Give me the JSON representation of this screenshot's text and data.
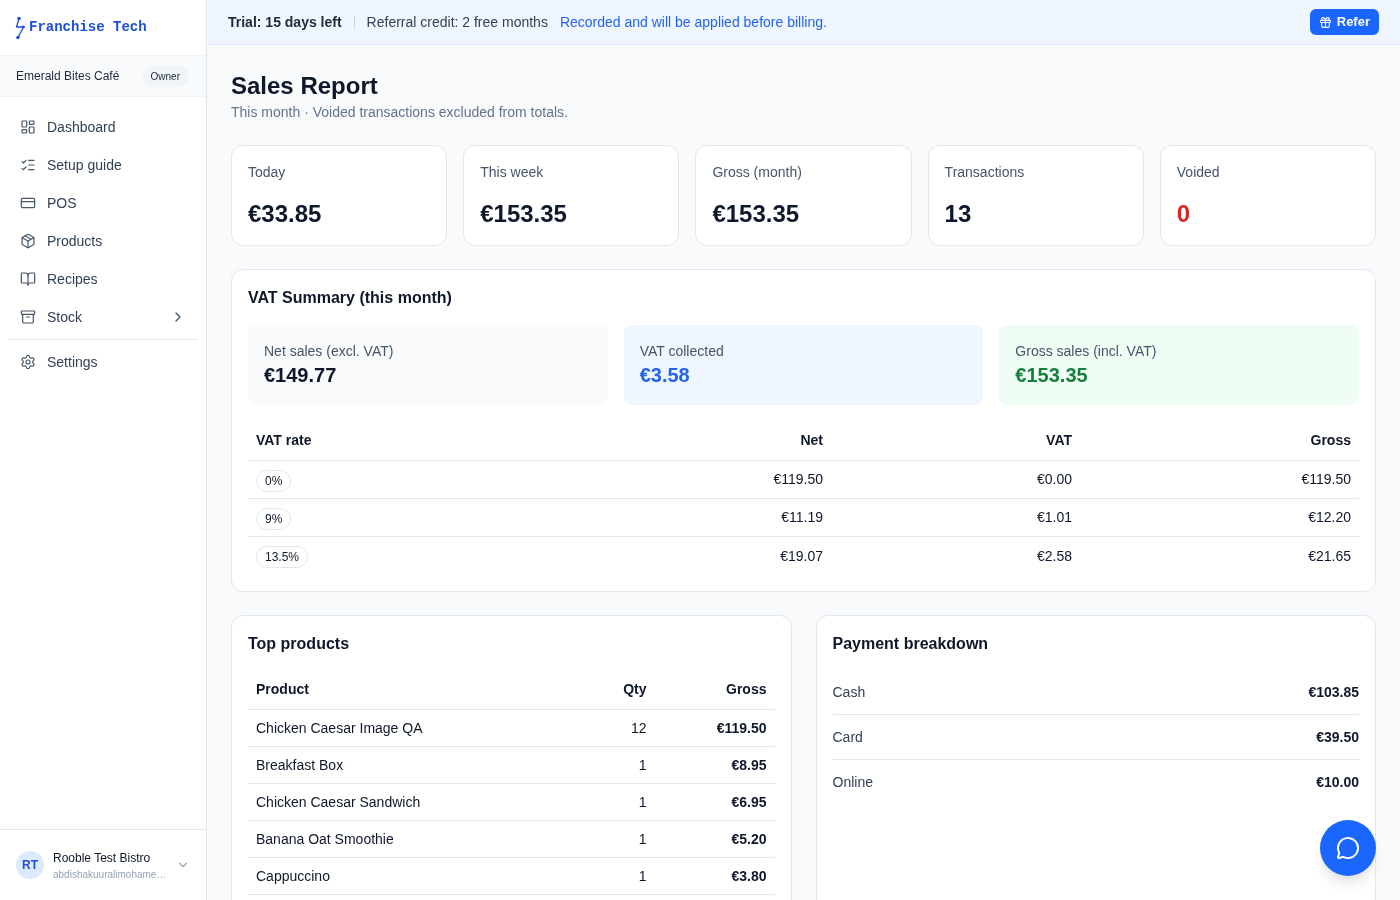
{
  "sidebar": {
    "brand": "Franchise Tech",
    "store": {
      "name": "Emerald Bites Café",
      "role": "Owner"
    },
    "nav": [
      {
        "label": "Dashboard",
        "kind": "link"
      },
      {
        "label": "Setup guide",
        "kind": "link"
      },
      {
        "label": "POS",
        "kind": "link"
      },
      {
        "label": "Products",
        "kind": "link"
      },
      {
        "label": "Recipes",
        "kind": "link"
      },
      {
        "label": "Stock",
        "kind": "group",
        "expanded": false
      }
    ],
    "secondary_nav": [
      {
        "label": "Settings",
        "kind": "link"
      }
    ],
    "user": {
      "initials": "RT",
      "name": "Rooble Test Bistro",
      "email": "abdishakuuralimohame…"
    }
  },
  "banner": {
    "trial": "Trial: 15 days left",
    "referral": "Referral credit: 2 free months",
    "note": "Recorded and will be applied before billing.",
    "button": "Refer"
  },
  "page": {
    "title": "Sales Report",
    "subtitle": "This month · Voided transactions excluded from totals."
  },
  "stats": [
    {
      "label": "Today",
      "value": "€33.85",
      "color": "#0f172a"
    },
    {
      "label": "This week",
      "value": "€153.35",
      "color": "#0f172a"
    },
    {
      "label": "Gross (month)",
      "value": "€153.35",
      "color": "#0f172a"
    },
    {
      "label": "Transactions",
      "value": "13",
      "color": "#0f172a"
    },
    {
      "label": "Voided",
      "value": "0",
      "color": "#dc2626"
    }
  ],
  "vat_summary": {
    "title": "VAT Summary (this month)",
    "totals": [
      {
        "label": "Net sales (excl. VAT)",
        "value": "€149.77",
        "kind": "neutral"
      },
      {
        "label": "VAT collected",
        "value": "€3.58",
        "kind": "info"
      },
      {
        "label": "Gross sales (incl. VAT)",
        "value": "€153.35",
        "kind": "success"
      }
    ],
    "table": {
      "columns": [
        "VAT rate",
        "Net",
        "VAT",
        "Gross"
      ],
      "rows": [
        {
          "rate": "0%",
          "net": "€119.50",
          "vat": "€0.00",
          "gross": "€119.50"
        },
        {
          "rate": "9%",
          "net": "€11.19",
          "vat": "€1.01",
          "gross": "€12.20"
        },
        {
          "rate": "13.5%",
          "net": "€19.07",
          "vat": "€2.58",
          "gross": "€21.65"
        }
      ]
    }
  },
  "top_products": {
    "title": "Top products",
    "columns": [
      "Product",
      "Qty",
      "Gross"
    ],
    "rows": [
      {
        "product": "Chicken Caesar Image QA",
        "qty": "12",
        "gross": "€119.50"
      },
      {
        "product": "Breakfast Box",
        "qty": "1",
        "gross": "€8.95"
      },
      {
        "product": "Chicken Caesar Sandwich",
        "qty": "1",
        "gross": "€6.95"
      },
      {
        "product": "Banana Oat Smoothie",
        "qty": "1",
        "gross": "€5.20"
      },
      {
        "product": "Cappuccino",
        "qty": "1",
        "gross": "€3.80"
      }
    ]
  },
  "payment_breakdown": {
    "title": "Payment breakdown",
    "rows": [
      {
        "method": "Cash",
        "amount": "€103.85"
      },
      {
        "method": "Card",
        "amount": "€39.50"
      },
      {
        "method": "Online",
        "amount": "€10.00"
      }
    ]
  }
}
